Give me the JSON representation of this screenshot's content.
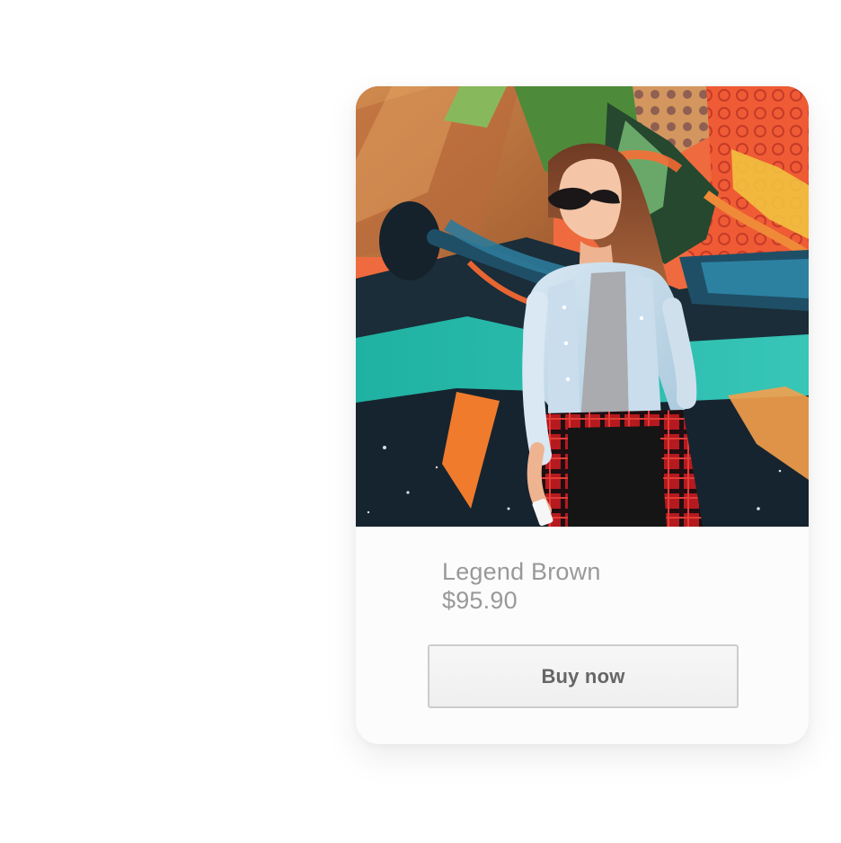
{
  "product": {
    "name": "Legend Brown",
    "price": "$95.90",
    "buy_label": "Buy now"
  },
  "colors": {
    "page_background": "#ffffff",
    "card_background": "#fcfcfc",
    "text_muted": "#999999",
    "button_text": "#666666",
    "button_border": "#cccccc"
  }
}
